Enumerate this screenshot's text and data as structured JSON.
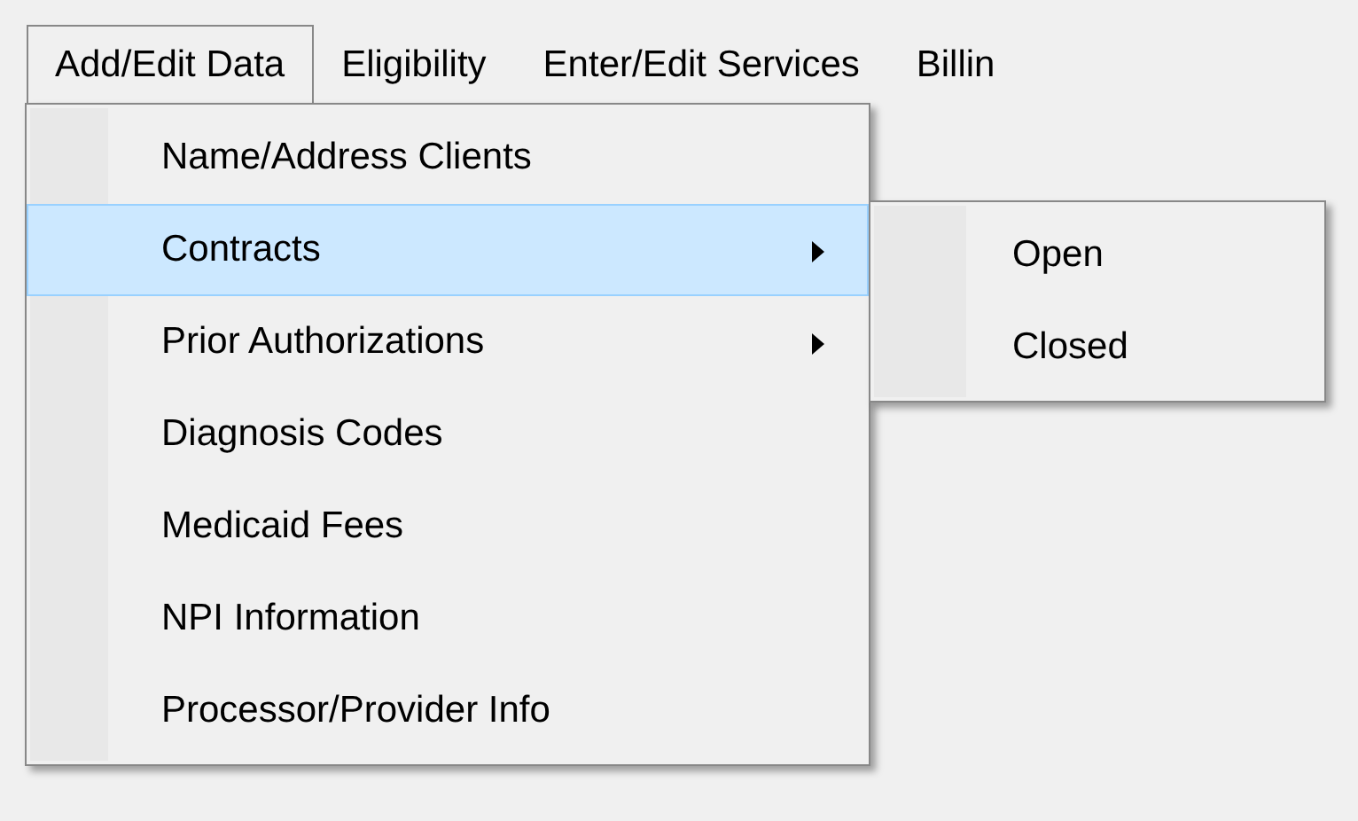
{
  "menu_bar": [
    {
      "label": "Add/Edit Data",
      "selected": true
    },
    {
      "label": "Eligibility",
      "selected": false
    },
    {
      "label": "Enter/Edit Services",
      "selected": false
    },
    {
      "label": "Billin",
      "selected": false
    }
  ],
  "dropdown": {
    "items": [
      {
        "label": "Name/Address Clients",
        "selected": false,
        "has_submenu": false
      },
      {
        "label": "Contracts",
        "selected": true,
        "has_submenu": true
      },
      {
        "label": "Prior Authorizations",
        "selected": false,
        "has_submenu": true
      },
      {
        "label": "Diagnosis Codes",
        "selected": false,
        "has_submenu": false
      },
      {
        "label": "Medicaid Fees",
        "selected": false,
        "has_submenu": false
      },
      {
        "label": "NPI Information",
        "selected": false,
        "has_submenu": false
      },
      {
        "label": "Processor/Provider Info",
        "selected": false,
        "has_submenu": false
      }
    ]
  },
  "submenu": {
    "items": [
      {
        "label": "Open",
        "selected": false
      },
      {
        "label": "Closed",
        "selected": false
      }
    ]
  }
}
